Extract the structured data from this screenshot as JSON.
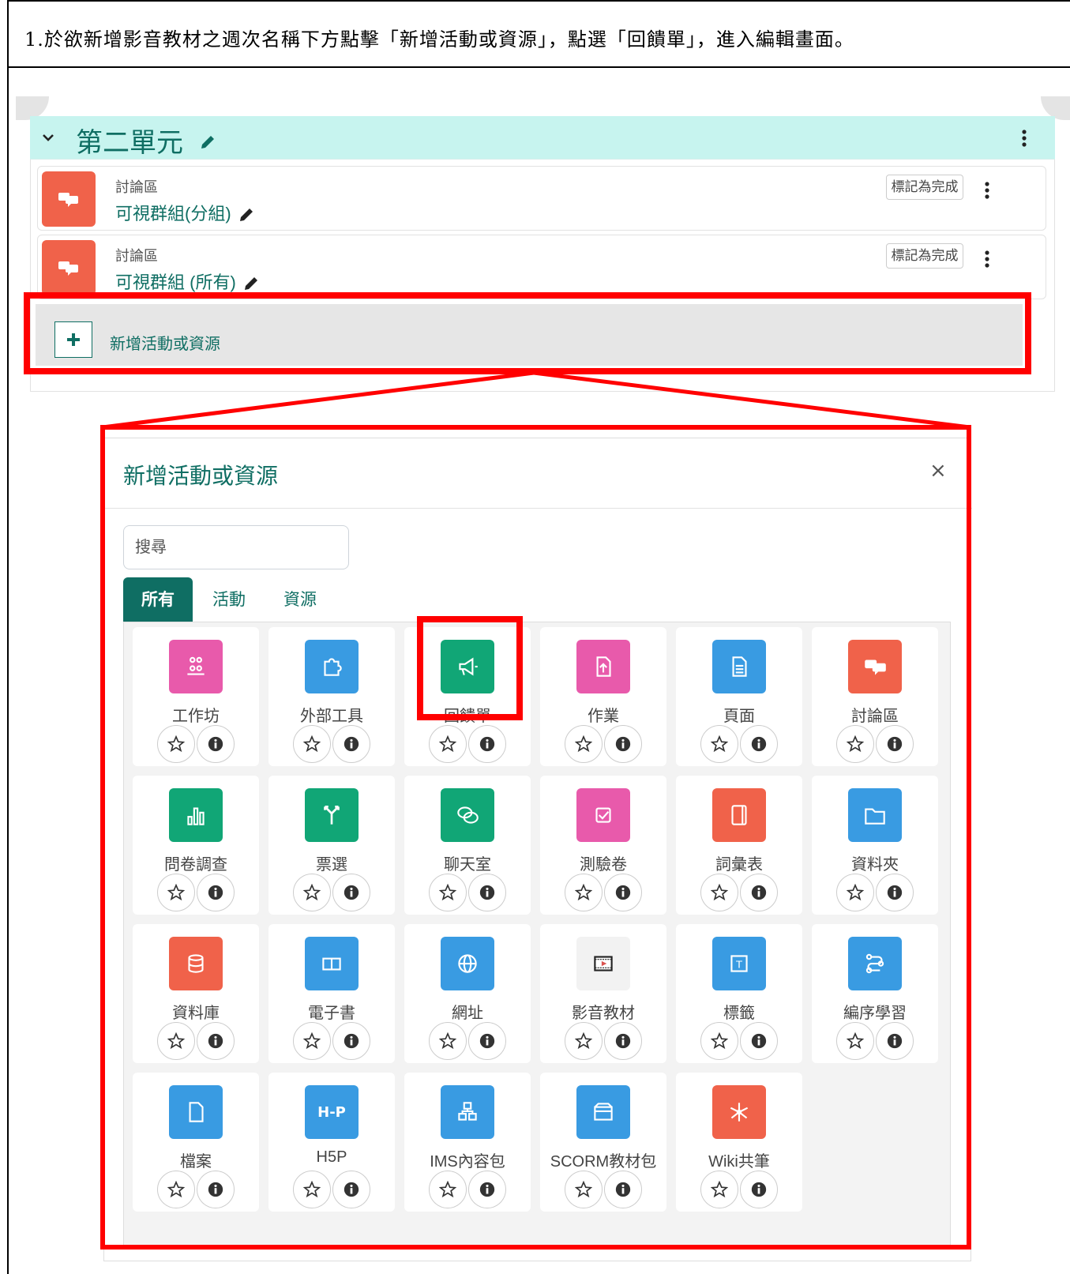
{
  "instruction": "1.於欲新增影音教材之週次名稱下方點擊「新增活動或資源」，點選「回饋單」，進入編輯畫面。",
  "section": {
    "title": "第二單元"
  },
  "activities": [
    {
      "type": "討論區",
      "name": "可視群組(分組)",
      "complete_label": "標記為完成"
    },
    {
      "type": "討論區",
      "name": "可視群組 (所有)",
      "complete_label": "標記為完成"
    }
  ],
  "add_activity": {
    "label": "新增活動或資源"
  },
  "modal": {
    "title": "新增活動或資源",
    "close": "×",
    "search_placeholder": "搜尋",
    "tabs": [
      {
        "label": "所有",
        "active": true
      },
      {
        "label": "活動",
        "active": false
      },
      {
        "label": "資源",
        "active": false
      }
    ],
    "items": [
      {
        "label": "工作坊",
        "color": "#e85aab",
        "icon": "workshop-icon"
      },
      {
        "label": "外部工具",
        "color": "#399be2",
        "icon": "puzzle-icon"
      },
      {
        "label": "回饋單",
        "color": "#11a676",
        "icon": "megaphone-icon"
      },
      {
        "label": "作業",
        "color": "#e85aab",
        "icon": "assignment-icon"
      },
      {
        "label": "頁面",
        "color": "#399be2",
        "icon": "page-icon"
      },
      {
        "label": "討論區",
        "color": "#f0624a",
        "icon": "forum-icon"
      },
      {
        "label": "問卷調查",
        "color": "#11a676",
        "icon": "bar-chart-icon"
      },
      {
        "label": "票選",
        "color": "#11a676",
        "icon": "choice-icon"
      },
      {
        "label": "聊天室",
        "color": "#11a676",
        "icon": "chat-icon"
      },
      {
        "label": "測驗卷",
        "color": "#e85aab",
        "icon": "quiz-icon"
      },
      {
        "label": "詞彙表",
        "color": "#f0624a",
        "icon": "glossary-icon"
      },
      {
        "label": "資料夾",
        "color": "#399be2",
        "icon": "folder-icon"
      },
      {
        "label": "資料庫",
        "color": "#f0624a",
        "icon": "database-icon"
      },
      {
        "label": "電子書",
        "color": "#399be2",
        "icon": "book-icon"
      },
      {
        "label": "網址",
        "color": "#399be2",
        "icon": "globe-icon"
      },
      {
        "label": "影音教材",
        "color": "#f2f2f2",
        "icon": "video-icon"
      },
      {
        "label": "標籤",
        "color": "#399be2",
        "icon": "label-icon"
      },
      {
        "label": "編序學習",
        "color": "#399be2",
        "icon": "lesson-icon"
      },
      {
        "label": "檔案",
        "color": "#399be2",
        "icon": "file-icon"
      },
      {
        "label": "H5P",
        "color": "#399be2",
        "icon": "h5p-icon"
      },
      {
        "label": "IMS內容包",
        "color": "#399be2",
        "icon": "ims-package-icon"
      },
      {
        "label": "SCORM教材包",
        "color": "#399be2",
        "icon": "scorm-icon"
      },
      {
        "label": "Wiki共筆",
        "color": "#f0624a",
        "icon": "wiki-icon"
      }
    ],
    "h5p_icon_text": "H-P"
  }
}
